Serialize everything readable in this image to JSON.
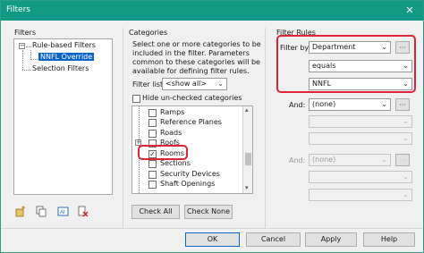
{
  "window": {
    "title": "Filters",
    "close_glyph": "✕"
  },
  "filters_panel": {
    "heading": "Filters",
    "tree": {
      "parent_label": "Rule-based Filters",
      "child_label": "NNFL Override",
      "sibling_label": "Selection Filters"
    }
  },
  "categories_panel": {
    "heading": "Categories",
    "description": [
      "Select one or more categories to be",
      "included in the filter. Parameters",
      "common to these categories will be",
      "available for defining filter rules."
    ],
    "filter_list_label": "Filter list:",
    "filter_list_value": "<show all>",
    "hide_unchecked_label": "Hide un-checked categories",
    "items": [
      {
        "label": "Ramps",
        "checked": false
      },
      {
        "label": "Reference Planes",
        "checked": false
      },
      {
        "label": "Roads",
        "checked": false
      },
      {
        "label": "Roofs",
        "checked": false
      },
      {
        "label": "Rooms",
        "checked": true
      },
      {
        "label": "Sections",
        "checked": false
      },
      {
        "label": "Security Devices",
        "checked": false
      },
      {
        "label": "Shaft Openings",
        "checked": false
      }
    ],
    "check_all_label": "Check All",
    "check_none_label": "Check None"
  },
  "filter_rules_panel": {
    "heading": "Filter Rules",
    "filter_by_label": "Filter by:",
    "rule1": {
      "parameter": "Department",
      "operator": "equals",
      "value": "NNFL"
    },
    "and_label": "And:",
    "rule2": {
      "parameter": "(none)"
    },
    "rule3": {
      "parameter": "(none)"
    }
  },
  "footer": {
    "ok_label": "OK",
    "cancel_label": "Cancel",
    "apply_label": "Apply",
    "help_label": "Help"
  },
  "colors": {
    "titlebar": "#129a86",
    "selection": "#0a63c9",
    "highlight": "#e0253a"
  }
}
